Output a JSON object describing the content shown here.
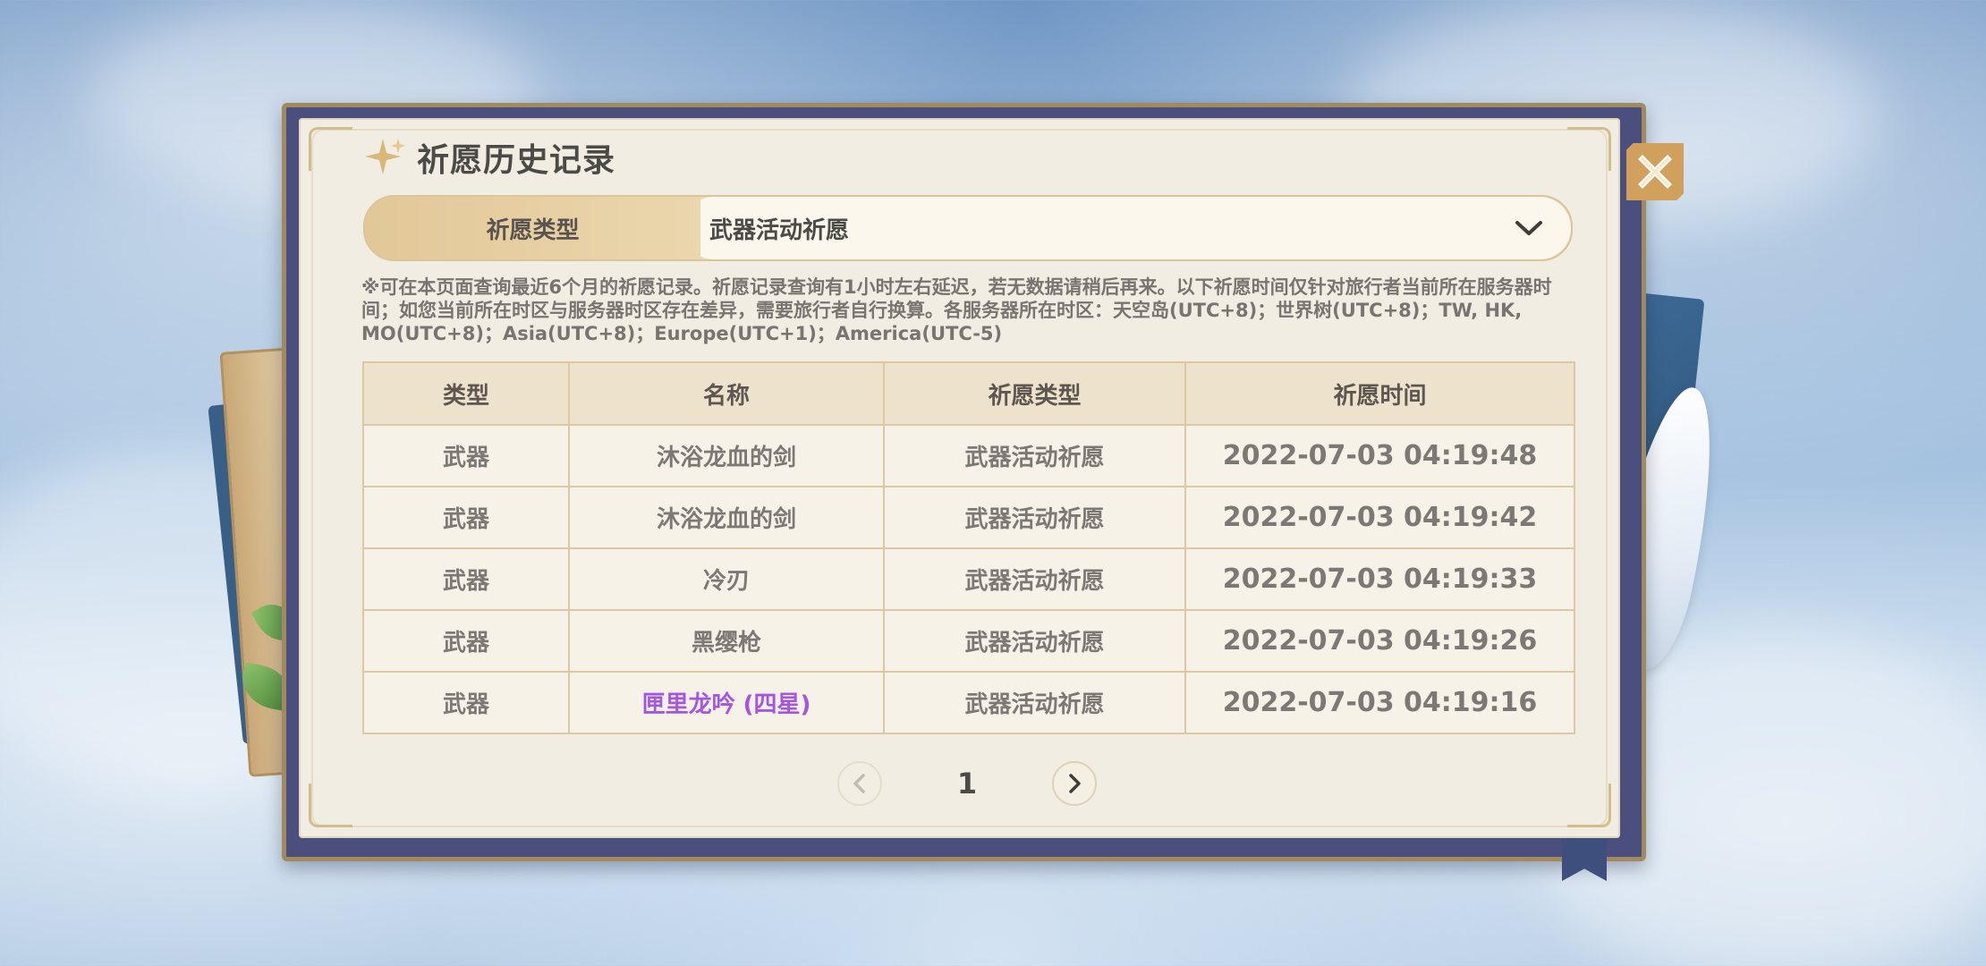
{
  "header": {
    "title": "祈愿历史记录"
  },
  "filter": {
    "label": "祈愿类型",
    "selected": "武器活动祈愿"
  },
  "notice": "※可在本页面查询最近6个月的祈愿记录。祈愿记录查询有1小时左右延迟，若无数据请稍后再来。以下祈愿时间仅针对旅行者当前所在服务器时间；如您当前所在时区与服务器时区存在差异，需要旅行者自行换算。各服务器所在时区：天空岛(UTC+8)；世界树(UTC+8)；TW, HK, MO(UTC+8)；Asia(UTC+8)；Europe(UTC+1)；America(UTC-5)",
  "table": {
    "headers": [
      "类型",
      "名称",
      "祈愿类型",
      "祈愿时间"
    ],
    "rows": [
      {
        "type": "武器",
        "name": "沐浴龙血的剑",
        "wish_type": "武器活动祈愿",
        "time": "2022-07-03 04:19:48",
        "rarity": "3"
      },
      {
        "type": "武器",
        "name": "沐浴龙血的剑",
        "wish_type": "武器活动祈愿",
        "time": "2022-07-03 04:19:42",
        "rarity": "3"
      },
      {
        "type": "武器",
        "name": "冷刃",
        "wish_type": "武器活动祈愿",
        "time": "2022-07-03 04:19:33",
        "rarity": "3"
      },
      {
        "type": "武器",
        "name": "黑缨枪",
        "wish_type": "武器活动祈愿",
        "time": "2022-07-03 04:19:26",
        "rarity": "3"
      },
      {
        "type": "武器",
        "name": "匣里龙吟 (四星)",
        "wish_type": "武器活动祈愿",
        "time": "2022-07-03 04:19:16",
        "rarity": "4"
      }
    ]
  },
  "pagination": {
    "current_page": "1"
  },
  "colors": {
    "four_star": "#a256e1",
    "frame": "#4a4f7e",
    "accent_gold": "#d2a05d"
  },
  "icons": {
    "title": "sparkle-icon",
    "dropdown": "chevron-down-icon",
    "prev": "chevron-left-icon",
    "next": "chevron-right-icon",
    "close": "close-icon"
  }
}
